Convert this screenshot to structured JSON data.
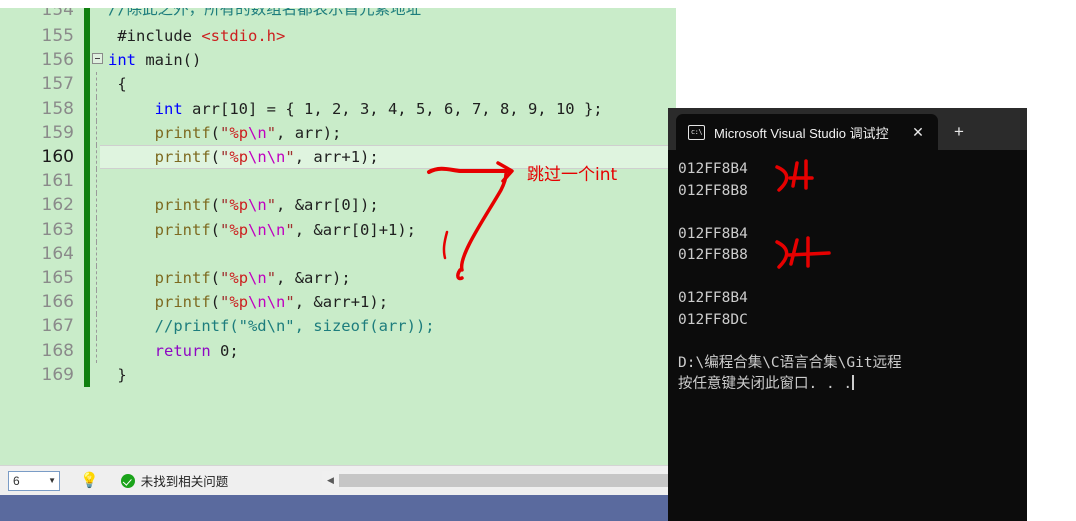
{
  "editor": {
    "name": "visual-studio-code-editor",
    "background_color": "#c9ecc9",
    "current_line": 160,
    "lines": [
      {
        "num": "154",
        "clipped": true,
        "fold": false,
        "tokens": [
          {
            "t": "//除此之外，所有的数组名都表示首元素地址",
            "c": "comment"
          }
        ]
      },
      {
        "num": "155",
        "clipped": false,
        "fold": false,
        "tokens": [
          {
            "t": " #include ",
            "c": "pre"
          },
          {
            "t": "<stdio.h>",
            "c": "inc"
          }
        ]
      },
      {
        "num": "156",
        "clipped": false,
        "fold": true,
        "tokens": [
          {
            "t": "int",
            "c": "kw"
          },
          {
            "t": " main()",
            "c": "ident"
          }
        ]
      },
      {
        "num": "157",
        "clipped": false,
        "fold": false,
        "tokens": [
          {
            "t": " {",
            "c": "punct"
          }
        ]
      },
      {
        "num": "158",
        "clipped": false,
        "fold": false,
        "tokens": [
          {
            "t": "     ",
            "c": "ident"
          },
          {
            "t": "int",
            "c": "kw"
          },
          {
            "t": " arr[10] = { 1, 2, 3, 4, 5, 6, 7, 8, 9, 10 };",
            "c": "ident"
          }
        ]
      },
      {
        "num": "159",
        "clipped": false,
        "fold": false,
        "tokens": [
          {
            "t": "     ",
            "c": "ident"
          },
          {
            "t": "printf",
            "c": "fn"
          },
          {
            "t": "(",
            "c": "punct"
          },
          {
            "t": "\"",
            "c": "str"
          },
          {
            "t": "%p",
            "c": "pct"
          },
          {
            "t": "\\n",
            "c": "esc"
          },
          {
            "t": "\"",
            "c": "str"
          },
          {
            "t": ", arr);",
            "c": "ident"
          }
        ]
      },
      {
        "num": "160",
        "clipped": false,
        "fold": false,
        "tokens": [
          {
            "t": "     ",
            "c": "ident"
          },
          {
            "t": "printf",
            "c": "fn"
          },
          {
            "t": "(",
            "c": "punct"
          },
          {
            "t": "\"",
            "c": "str"
          },
          {
            "t": "%p",
            "c": "pct"
          },
          {
            "t": "\\n\\n",
            "c": "esc"
          },
          {
            "t": "\"",
            "c": "str"
          },
          {
            "t": ", arr+1);",
            "c": "ident"
          }
        ]
      },
      {
        "num": "161",
        "clipped": false,
        "fold": false,
        "tokens": [
          {
            "t": "",
            "c": "ident"
          }
        ]
      },
      {
        "num": "162",
        "clipped": false,
        "fold": false,
        "tokens": [
          {
            "t": "     ",
            "c": "ident"
          },
          {
            "t": "printf",
            "c": "fn"
          },
          {
            "t": "(",
            "c": "punct"
          },
          {
            "t": "\"",
            "c": "str"
          },
          {
            "t": "%p",
            "c": "pct"
          },
          {
            "t": "\\n",
            "c": "esc"
          },
          {
            "t": "\"",
            "c": "str"
          },
          {
            "t": ", &arr[0]);",
            "c": "ident"
          }
        ]
      },
      {
        "num": "163",
        "clipped": false,
        "fold": false,
        "tokens": [
          {
            "t": "     ",
            "c": "ident"
          },
          {
            "t": "printf",
            "c": "fn"
          },
          {
            "t": "(",
            "c": "punct"
          },
          {
            "t": "\"",
            "c": "str"
          },
          {
            "t": "%p",
            "c": "pct"
          },
          {
            "t": "\\n\\n",
            "c": "esc"
          },
          {
            "t": "\"",
            "c": "str"
          },
          {
            "t": ", &arr[0]+1);",
            "c": "ident"
          }
        ]
      },
      {
        "num": "164",
        "clipped": false,
        "fold": false,
        "tokens": [
          {
            "t": "",
            "c": "ident"
          }
        ]
      },
      {
        "num": "165",
        "clipped": false,
        "fold": false,
        "tokens": [
          {
            "t": "     ",
            "c": "ident"
          },
          {
            "t": "printf",
            "c": "fn"
          },
          {
            "t": "(",
            "c": "punct"
          },
          {
            "t": "\"",
            "c": "str"
          },
          {
            "t": "%p",
            "c": "pct"
          },
          {
            "t": "\\n",
            "c": "esc"
          },
          {
            "t": "\"",
            "c": "str"
          },
          {
            "t": ", &arr);",
            "c": "ident"
          }
        ]
      },
      {
        "num": "166",
        "clipped": false,
        "fold": false,
        "tokens": [
          {
            "t": "     ",
            "c": "ident"
          },
          {
            "t": "printf",
            "c": "fn"
          },
          {
            "t": "(",
            "c": "punct"
          },
          {
            "t": "\"",
            "c": "str"
          },
          {
            "t": "%p",
            "c": "pct"
          },
          {
            "t": "\\n\\n",
            "c": "esc"
          },
          {
            "t": "\"",
            "c": "str"
          },
          {
            "t": ", &arr+1);",
            "c": "ident"
          }
        ]
      },
      {
        "num": "167",
        "clipped": false,
        "fold": false,
        "tokens": [
          {
            "t": "     //printf(\"%d\\n\", sizeof(arr));",
            "c": "comment"
          }
        ]
      },
      {
        "num": "168",
        "clipped": false,
        "fold": false,
        "tokens": [
          {
            "t": "     ",
            "c": "ident"
          },
          {
            "t": "return",
            "c": "kw2"
          },
          {
            "t": " 0;",
            "c": "ident"
          }
        ]
      },
      {
        "num": "169",
        "clipped": false,
        "fold": false,
        "tokens": [
          {
            "t": " }",
            "c": "punct"
          }
        ]
      }
    ]
  },
  "status_bar": {
    "zoom_value": "6",
    "zoom_caret": "▼",
    "bulb_icon": "lightbulb-icon",
    "issues_text": "未找到相关问题",
    "scroll_left_arrow": "◀"
  },
  "console": {
    "tab": {
      "app_icon_label": "c:\\",
      "title": "Microsoft Visual Studio 调试控",
      "close_label": "✕",
      "new_tab_label": "+"
    },
    "output_lines": [
      "012FF8B4",
      "012FF8B8",
      "",
      "012FF8B4",
      "012FF8B8",
      "",
      "012FF8B4",
      "012FF8DC",
      "",
      "D:\\编程合集\\C语言合集\\Git远程",
      "按任意键关闭此窗口. . ."
    ]
  },
  "annotations": {
    "ink_color": "#e60000",
    "note_skip_int": "跳过一个int",
    "mark_4_upper": "4",
    "mark_4_lower": "4"
  }
}
